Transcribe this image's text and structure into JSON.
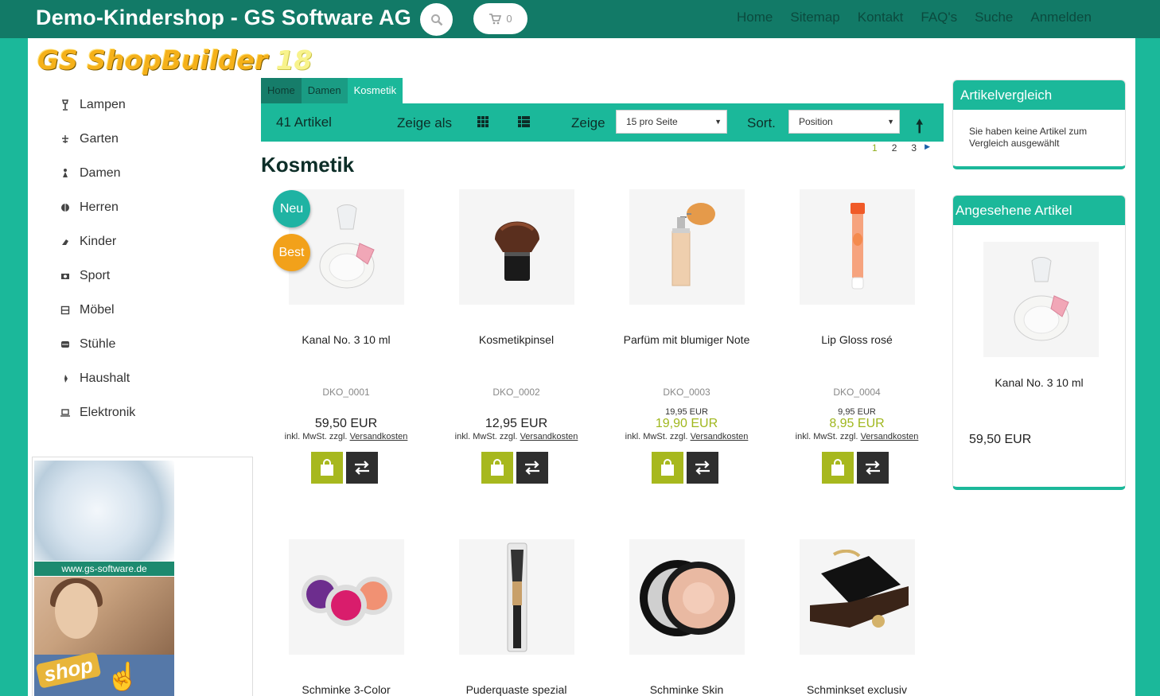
{
  "header": {
    "title": "Demo-Kindershop - GS Software AG",
    "cart_count": "0",
    "nav": [
      "Home",
      "Sitemap",
      "Kontakt",
      "FAQ's",
      "Suche",
      "Anmelden"
    ]
  },
  "logo": {
    "text": "GS ShopBuilder",
    "version": "18"
  },
  "categories": [
    {
      "label": "Lampen",
      "icon": "lamp-icon"
    },
    {
      "label": "Garten",
      "icon": "garden-icon"
    },
    {
      "label": "Damen",
      "icon": "female-icon"
    },
    {
      "label": "Herren",
      "icon": "male-icon"
    },
    {
      "label": "Kinder",
      "icon": "child-icon"
    },
    {
      "label": "Sport",
      "icon": "sport-icon"
    },
    {
      "label": "Möbel",
      "icon": "furniture-icon"
    },
    {
      "label": "Stühle",
      "icon": "chair-icon"
    },
    {
      "label": "Haushalt",
      "icon": "household-icon"
    },
    {
      "label": "Elektronik",
      "icon": "electronics-icon"
    }
  ],
  "banner": {
    "url": "www.gs-software.de",
    "shop_label": "shop"
  },
  "breadcrumb": [
    "Home",
    "Damen",
    "Kosmetik"
  ],
  "toolbar": {
    "count": "41 Artikel",
    "show_as": "Zeige als",
    "show": "Zeige",
    "per_page": "15 pro Seite",
    "sort": "Sort.",
    "sort_value": "Position"
  },
  "pagination": [
    "1",
    "2",
    "3"
  ],
  "heading": "Kosmetik",
  "badges": {
    "new": "Neu",
    "best": "Best"
  },
  "products": [
    {
      "name": "Kanal No. 3 10 ml",
      "sku": "DKO_0001",
      "old_price": "",
      "price": "59,50 EUR",
      "special": false
    },
    {
      "name": "Kosmetikpinsel",
      "sku": "DKO_0002",
      "old_price": "",
      "price": "12,95 EUR",
      "special": false
    },
    {
      "name": "Parfüm mit blumiger Note",
      "sku": "DKO_0003",
      "old_price": "19,95 EUR",
      "price": "19,90 EUR",
      "special": true
    },
    {
      "name": "Lip Gloss rosé",
      "sku": "DKO_0004",
      "old_price": "9,95 EUR",
      "price": "8,95 EUR",
      "special": true
    },
    {
      "name": "Schminke 3-Color"
    },
    {
      "name": "Puderquaste spezial"
    },
    {
      "name": "Schminke Skin"
    },
    {
      "name": "Schminkset exclusiv"
    }
  ],
  "tax_text": "inkl. MwSt. zzgl.",
  "shipping_link": "Versandkosten",
  "compare": {
    "title": "Artikelvergleich",
    "empty": "Sie haben keine Artikel zum Vergleich ausgewählt"
  },
  "viewed": {
    "title": "Angesehene Artikel",
    "name": "Kanal No. 3 10 ml",
    "price": "59,50 EUR"
  },
  "colors": {
    "accent": "#1bb89a",
    "topbar": "#127a67",
    "cart_button": "#a7b81e",
    "special_price": "#a0b71e"
  }
}
